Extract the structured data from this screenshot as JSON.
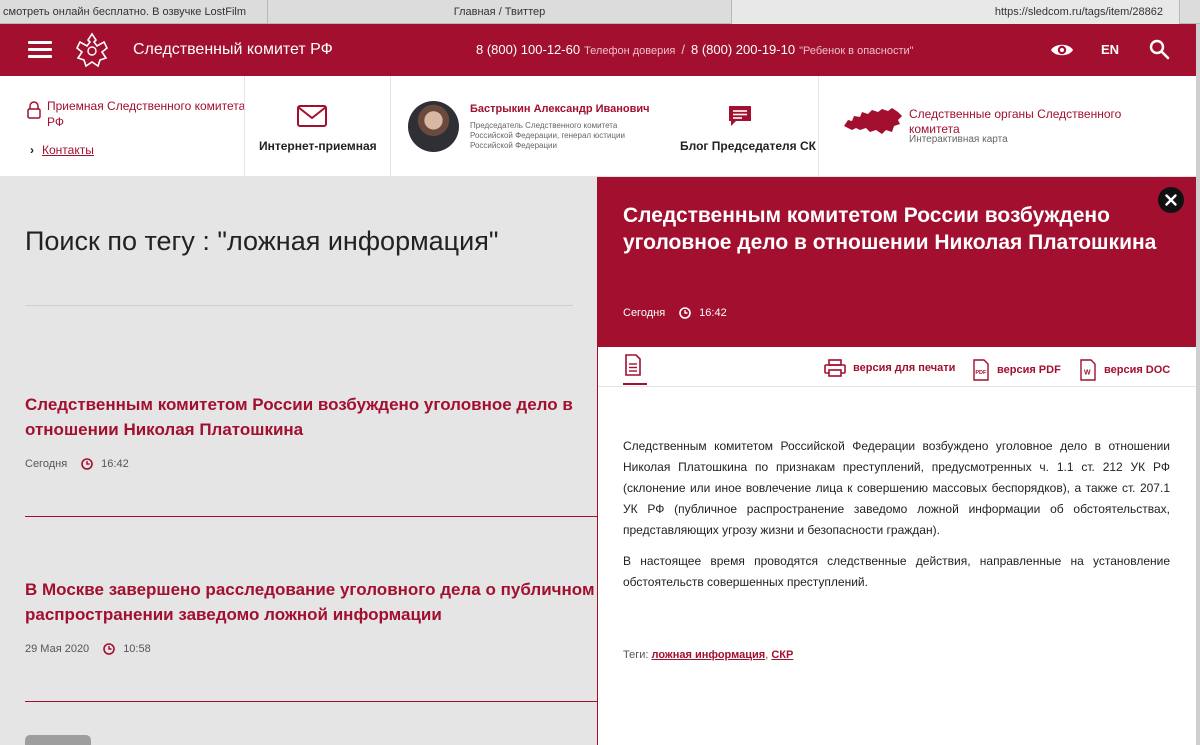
{
  "browser": {
    "tabs": [
      "смотреть онлайн бесплатно. В озвучке LostFilm",
      "Главная / Твиттер",
      "https://sledcom.ru/tags/item/28862"
    ]
  },
  "header": {
    "title": "Следственный комитет РФ",
    "phone1": "8 (800) 100-12-60",
    "phone1_note": "Телефон доверия",
    "separator": "/",
    "phone2": "8 (800) 200-19-10",
    "phone2_note": "\"Ребенок в опасности\"",
    "lang": "EN",
    "icons": [
      "menu-icon",
      "emblem-icon",
      "eye-icon",
      "search-icon"
    ]
  },
  "infobar": {
    "reception": "Приемная Следственного комитета РФ",
    "contacts": "Контакты",
    "internet_reception": "Интернет-приемная",
    "chairman_name": "Бастрыкин Александр Иванович",
    "chairman_role": "Председатель Следственного комитета Российской Федерации, генерал юстиции Российской Федерации",
    "blog": "Блог Председателя СК",
    "organs": "Следственные органы Следственного комитета",
    "map_sub": "Интерактивная карта"
  },
  "search": {
    "heading": "Поиск по тегу : \"ложная информация\"",
    "results": [
      {
        "title": "Следственным комитетом России возбуждено уголовное дело в отношении Николая Платошкина",
        "date": "Сегодня",
        "time": "16:42"
      },
      {
        "title": "В Москве завершено расследование уголовного дела о публичном распространении заведомо ложной информации",
        "date": "29 Мая 2020",
        "time": "10:58"
      }
    ]
  },
  "article": {
    "title": "Следственным комитетом России возбуждено уголовное дело в отношении Николая Платошкина",
    "date": "Сегодня",
    "time": "16:42",
    "print_label": "версия для печати",
    "pdf_label": "версия PDF",
    "doc_label": "версия DOC",
    "paragraph1": "Следственным комитетом Российской Федерации возбуждено уголовное дело в отношении Николая Платошкина по признакам преступлений, предусмотренных ч. 1.1 ст. 212 УК РФ (склонение или иное вовлечение лица к совершению массовых беспорядков), а также ст. 207.1 УК РФ (публичное распространение заведомо ложной информации об обстоятельствах, представляющих угрозу жизни и безопасности граждан).",
    "paragraph2": "В настоящее время проводятся следственные действия, направленные на установление обстоятельств совершенных преступлений.",
    "tags_label": "Теги:",
    "tag1": "ложная информация",
    "tag_sep": ",",
    "tag2": "СКР"
  },
  "colors": {
    "brand": "#a20f2f",
    "panel_grey": "#e5e5e5"
  }
}
